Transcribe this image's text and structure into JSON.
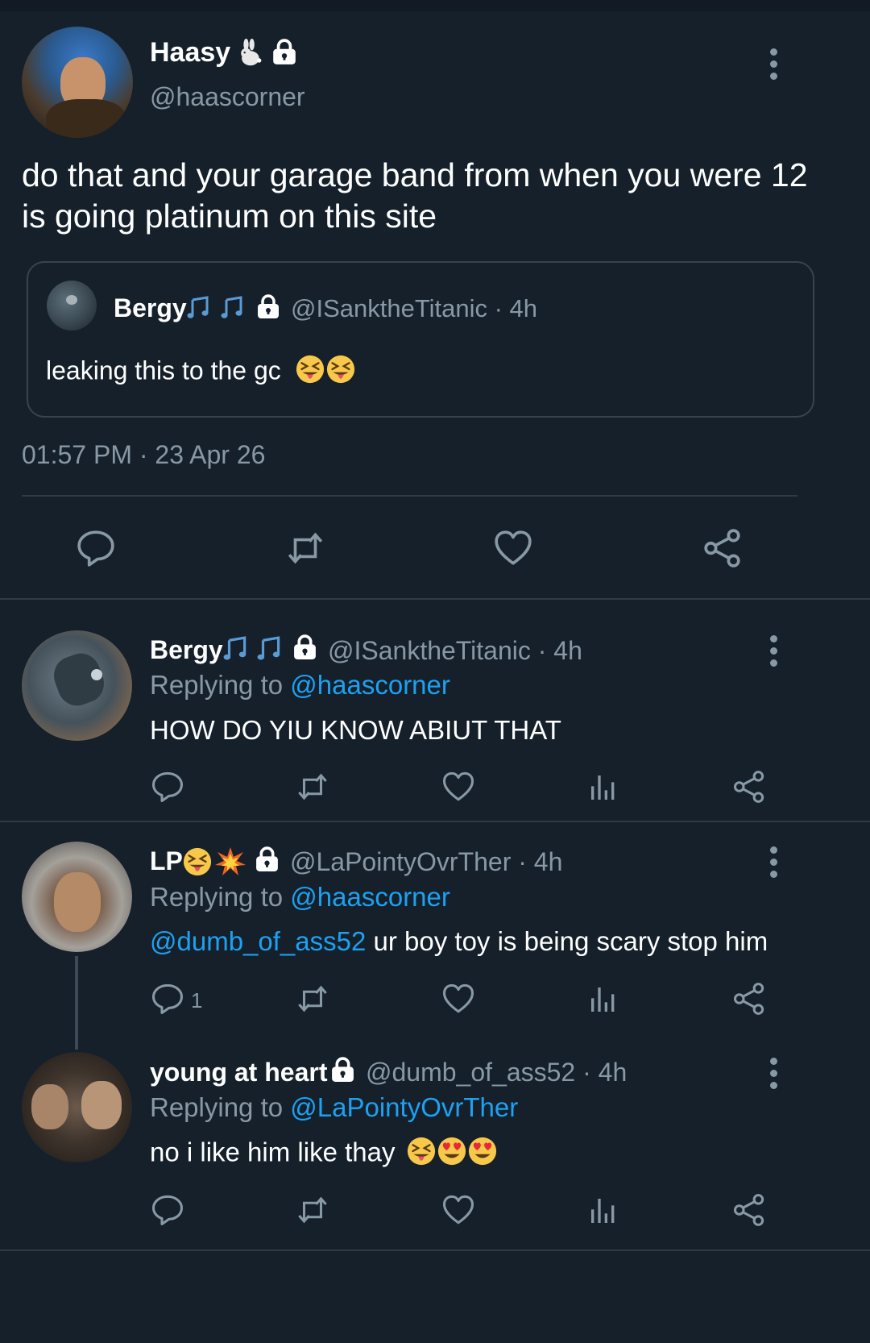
{
  "main_tweet": {
    "display_name": "Haasy",
    "handle": "@haascorner",
    "text": "do that and your garage band from when you were 12 is going platinum on this site",
    "timestamp": "01:57 PM · 23 Apr 26",
    "quoted": {
      "display_name": "Bergy",
      "handle_time": "@ISanktheTitanic · 4h",
      "text": "leaking this to the gc"
    }
  },
  "replies": [
    {
      "display_name": "Bergy",
      "handle_time": "@ISanktheTitanic · 4h",
      "replying_prefix": "Replying to",
      "replying_to": "@haascorner",
      "text": "HOW DO YIU KNOW ABIUT THAT"
    },
    {
      "display_name": "LP",
      "handle_time": "@LaPointyOvrTher · 4h",
      "replying_prefix": "Replying to",
      "replying_to": "@haascorner",
      "mention": "@dumb_of_ass52",
      "text": " ur boy toy is being scary stop him",
      "reply_count": "1"
    },
    {
      "display_name": "young at heart",
      "handle_time": "@dumb_of_ass52 · 4h",
      "replying_prefix": "Replying to",
      "replying_to": "@LaPointyOvrTher",
      "text": "no i like him like thay"
    }
  ],
  "colors": {
    "background": "#15202b",
    "muted": "#8899a6",
    "link": "#1da1f2",
    "separator": "#2f3b47"
  },
  "icons": [
    "rabbit-icon",
    "lock-icon",
    "music-note-icon",
    "reply-icon",
    "retweet-icon",
    "like-icon",
    "analytics-icon",
    "share-icon",
    "more-icon"
  ]
}
